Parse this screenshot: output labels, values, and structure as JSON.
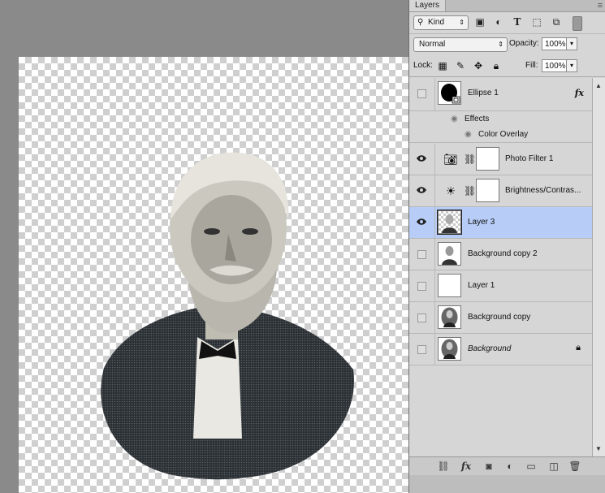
{
  "panel": {
    "tab_label": "Layers",
    "menu_icon": "panel-menu-icon",
    "filter": {
      "kind_label": "Kind",
      "icons": [
        "image-filter-icon",
        "adjustment-filter-icon",
        "type-filter-icon",
        "shape-filter-icon",
        "smart-object-filter-icon"
      ]
    },
    "blend_mode": "Normal",
    "opacity_label": "Opacity:",
    "opacity_value": "100%",
    "lock_label": "Lock:",
    "fill_label": "Fill:",
    "fill_value": "100%"
  },
  "layers": [
    {
      "name": "Ellipse 1",
      "visible": false,
      "kind": "shape",
      "fx": "fx"
    },
    {
      "name": "Photo Filter 1",
      "visible": true,
      "kind": "adjustment"
    },
    {
      "name": "Brightness/Contras...",
      "visible": true,
      "kind": "adjustment"
    },
    {
      "name": "Layer 3",
      "visible": true,
      "kind": "pixel",
      "selected": true
    },
    {
      "name": "Background copy 2",
      "visible": false,
      "kind": "pixel"
    },
    {
      "name": "Layer 1",
      "visible": false,
      "kind": "pixel"
    },
    {
      "name": "Background copy",
      "visible": false,
      "kind": "pixel"
    },
    {
      "name": "Background",
      "visible": false,
      "kind": "pixel",
      "locked": true
    }
  ],
  "effects": {
    "label": "Effects",
    "items": [
      "Color Overlay"
    ]
  },
  "colors": {
    "panel_bg": "#d6d6d6",
    "selected_row": "#b7cdf7",
    "workspace": "#8a8a8a"
  }
}
